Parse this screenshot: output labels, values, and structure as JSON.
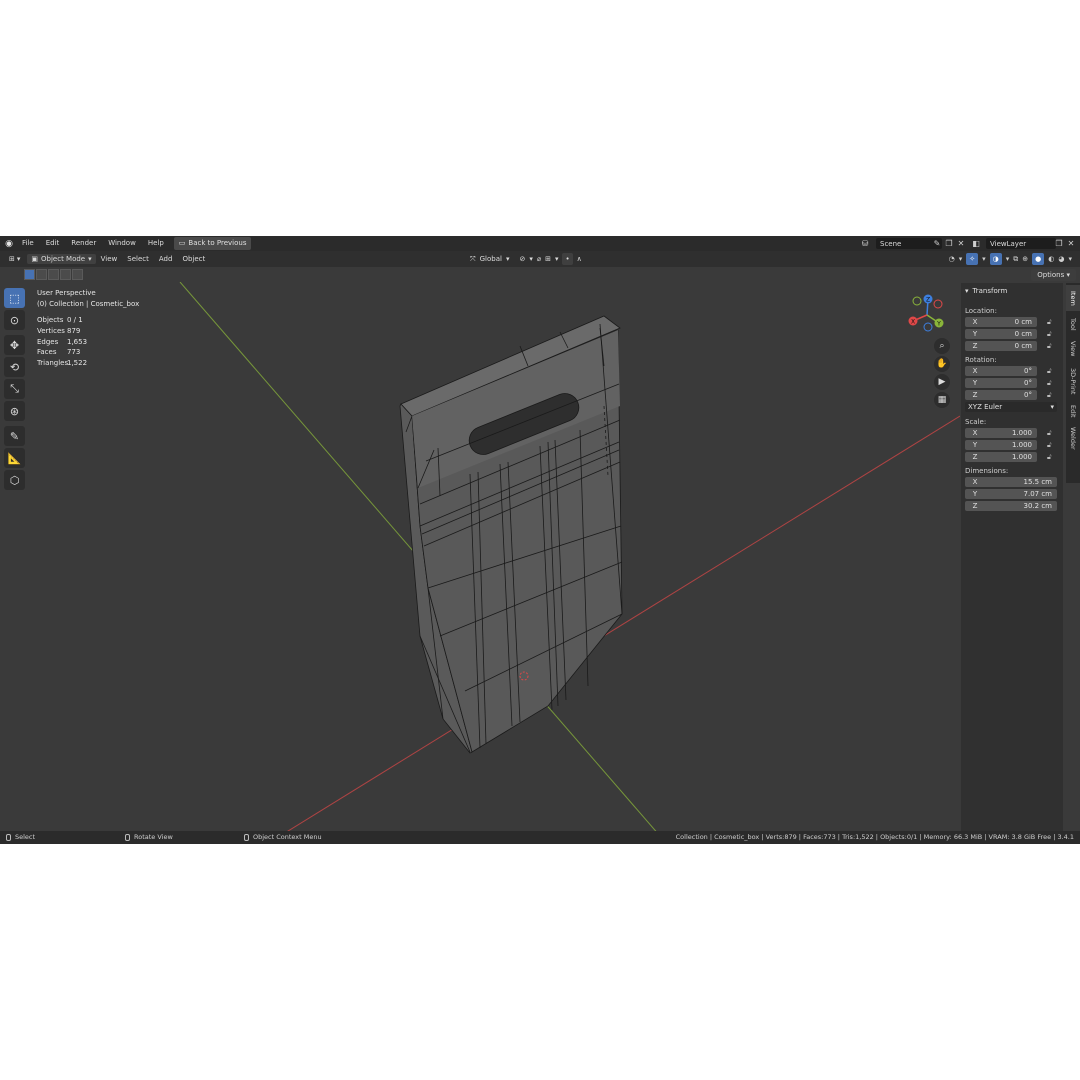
{
  "topbar": {
    "menus": [
      "File",
      "Edit",
      "Render",
      "Window",
      "Help"
    ],
    "back_button": "Back to Previous",
    "scene": "Scene",
    "view_layer": "ViewLayer"
  },
  "header": {
    "mode": "Object Mode",
    "menus": [
      "View",
      "Select",
      "Add",
      "Object"
    ],
    "orientation": "Global",
    "options": "Options"
  },
  "viewport": {
    "perspective": "User Perspective",
    "collection": "(0) Collection | Cosmetic_box",
    "stats": [
      {
        "label": "Objects",
        "value": "0 / 1"
      },
      {
        "label": "Vertices",
        "value": "879"
      },
      {
        "label": "Edges",
        "value": "1,653"
      },
      {
        "label": "Faces",
        "value": "773"
      },
      {
        "label": "Triangles",
        "value": "1,522"
      }
    ],
    "gizmo": {
      "x": "X",
      "y": "Y",
      "z": "Z"
    }
  },
  "npanel": {
    "title": "Transform",
    "location_label": "Location:",
    "location": [
      {
        "axis": "X",
        "value": "0 cm"
      },
      {
        "axis": "Y",
        "value": "0 cm"
      },
      {
        "axis": "Z",
        "value": "0 cm"
      }
    ],
    "rotation_label": "Rotation:",
    "rotation": [
      {
        "axis": "X",
        "value": "0°"
      },
      {
        "axis": "Y",
        "value": "0°"
      },
      {
        "axis": "Z",
        "value": "0°"
      }
    ],
    "rotation_mode": "XYZ Euler",
    "scale_label": "Scale:",
    "scale": [
      {
        "axis": "X",
        "value": "1.000"
      },
      {
        "axis": "Y",
        "value": "1.000"
      },
      {
        "axis": "Z",
        "value": "1.000"
      }
    ],
    "dimensions_label": "Dimensions:",
    "dimensions": [
      {
        "axis": "X",
        "value": "15.5 cm"
      },
      {
        "axis": "Y",
        "value": "7.07 cm"
      },
      {
        "axis": "Z",
        "value": "30.2 cm"
      }
    ],
    "tabs": [
      "Item",
      "Tool",
      "View",
      "3D-Print",
      "Edit",
      "Welder"
    ]
  },
  "statusbar": {
    "select": "Select",
    "rotate": "Rotate View",
    "context": "Object Context Menu",
    "info": "Collection | Cosmetic_box | Verts:879 | Faces:773 | Tris:1,522 | Objects:0/1 | Memory: 66.3 MiB | VRAM: 3.8 GiB Free | 3.4.1"
  },
  "colors": {
    "accent": "#4772b3",
    "x_axis": "#e04848",
    "y_axis": "#8ab53a",
    "z_axis": "#3d7fdf"
  }
}
